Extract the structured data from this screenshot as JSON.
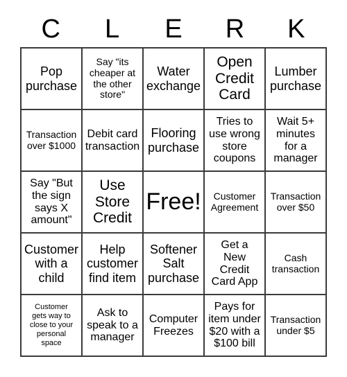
{
  "card": {
    "title_letters": [
      "C",
      "L",
      "E",
      "R",
      "K"
    ],
    "border_color": "#3a3a3a",
    "background_color": "#ffffff",
    "text_color": "#000000",
    "rows": 5,
    "columns": 5,
    "cells": [
      {
        "text": "Pop\npurchase",
        "size": "lg"
      },
      {
        "text": "Say \"its\ncheaper at\nthe other\nstore\"",
        "size": "sm"
      },
      {
        "text": "Water\nexchange",
        "size": "lg"
      },
      {
        "text": "Open\nCredit\nCard",
        "size": "xl"
      },
      {
        "text": "Lumber\npurchase",
        "size": "lg"
      },
      {
        "text": "Transaction\nover $1000",
        "size": "sm"
      },
      {
        "text": "Debit card\ntransaction",
        "size": "md"
      },
      {
        "text": "Flooring\npurchase",
        "size": "lg"
      },
      {
        "text": "Tries to\nuse wrong\nstore\ncoupons",
        "size": "md"
      },
      {
        "text": "Wait 5+\nminutes\nfor a\nmanager",
        "size": "md"
      },
      {
        "text": "Say \"But\nthe sign\nsays X\namount\"",
        "size": "md"
      },
      {
        "text": "Use\nStore\nCredit",
        "size": "xl"
      },
      {
        "text": "Free!",
        "size": "free"
      },
      {
        "text": "Customer\nAgreement",
        "size": "sm"
      },
      {
        "text": "Transaction\nover $50",
        "size": "sm"
      },
      {
        "text": "Customer\nwith a\nchild",
        "size": "lg"
      },
      {
        "text": "Help\ncustomer\nfind item",
        "size": "lg"
      },
      {
        "text": "Softener\nSalt\npurchase",
        "size": "lg"
      },
      {
        "text": "Get a\nNew\nCredit\nCard App",
        "size": "md"
      },
      {
        "text": "Cash\ntransaction",
        "size": "sm"
      },
      {
        "text": "Customer\ngets way to\nclose to your\npersonal\nspace",
        "size": "xs"
      },
      {
        "text": "Ask to\nspeak to a\nmanager",
        "size": "md"
      },
      {
        "text": "Computer\nFreezes",
        "size": "md"
      },
      {
        "text": "Pays for\nitem under\n$20 with a\n$100 bill",
        "size": "md"
      },
      {
        "text": "Transaction\nunder $5",
        "size": "sm"
      }
    ]
  }
}
